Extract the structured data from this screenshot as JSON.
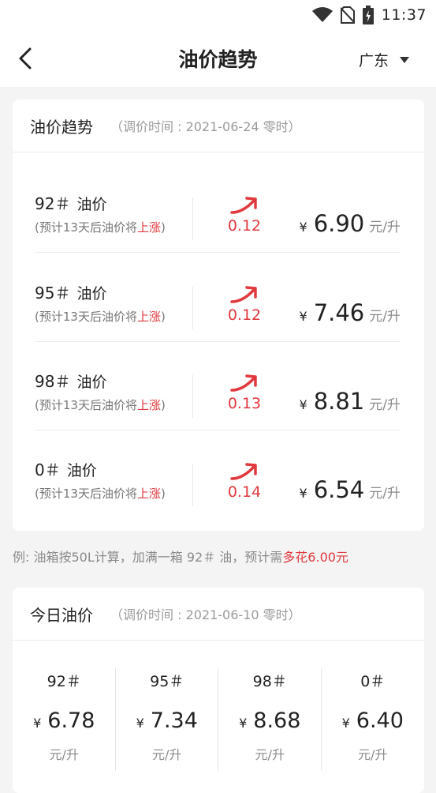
{
  "status": {
    "time": "11:37"
  },
  "nav": {
    "title": "油价趋势",
    "region": "广东"
  },
  "trend": {
    "title": "油价趋势",
    "adjust_time": "（调价时间 : 2021-06-24 零时）",
    "items": [
      {
        "grade": "92＃",
        "unit": "油价",
        "note_prefix": "(预计13天后油价将",
        "note_emph": "上涨",
        "note_suffix": ")",
        "delta": "0.12",
        "yen": "¥",
        "price": "6.90",
        "per": "元/升"
      },
      {
        "grade": "95＃",
        "unit": "油价",
        "note_prefix": "(预计13天后油价将",
        "note_emph": "上涨",
        "note_suffix": ")",
        "delta": "0.12",
        "yen": "¥",
        "price": "7.46",
        "per": "元/升"
      },
      {
        "grade": "98＃",
        "unit": "油价",
        "note_prefix": "(预计13天后油价将",
        "note_emph": "上涨",
        "note_suffix": ")",
        "delta": "0.13",
        "yen": "¥",
        "price": "8.81",
        "per": "元/升"
      },
      {
        "grade": "0＃",
        "unit": "油价",
        "note_prefix": "(预计13天后油价将",
        "note_emph": "上涨",
        "note_suffix": ")",
        "delta": "0.14",
        "yen": "¥",
        "price": "6.54",
        "per": "元/升"
      }
    ]
  },
  "example": {
    "text": "例: 油箱按50L计算，加满一箱 92＃ 油，预计需",
    "emph": "多花6.00元"
  },
  "today": {
    "title": "今日油价",
    "adjust_time": "（调价时间 : 2021-06-10 零时）",
    "items": [
      {
        "grade": "92＃",
        "yen": "¥",
        "price": "6.78",
        "unit": "元/升"
      },
      {
        "grade": "95＃",
        "yen": "¥",
        "price": "7.34",
        "unit": "元/升"
      },
      {
        "grade": "98＃",
        "yen": "¥",
        "price": "8.68",
        "unit": "元/升"
      },
      {
        "grade": "0＃",
        "yen": "¥",
        "price": "6.40",
        "unit": "元/升"
      }
    ]
  },
  "colors": {
    "accent_red": "#e0393e",
    "bg": "#f4f4f5"
  },
  "icons": {
    "wifi": "wifi-icon",
    "no_sim": "no-sim-icon",
    "battery": "battery-charging-icon",
    "back": "back-arrow-icon",
    "dropdown": "caret-down-icon",
    "trend_up": "trend-up-arrow-icon"
  }
}
